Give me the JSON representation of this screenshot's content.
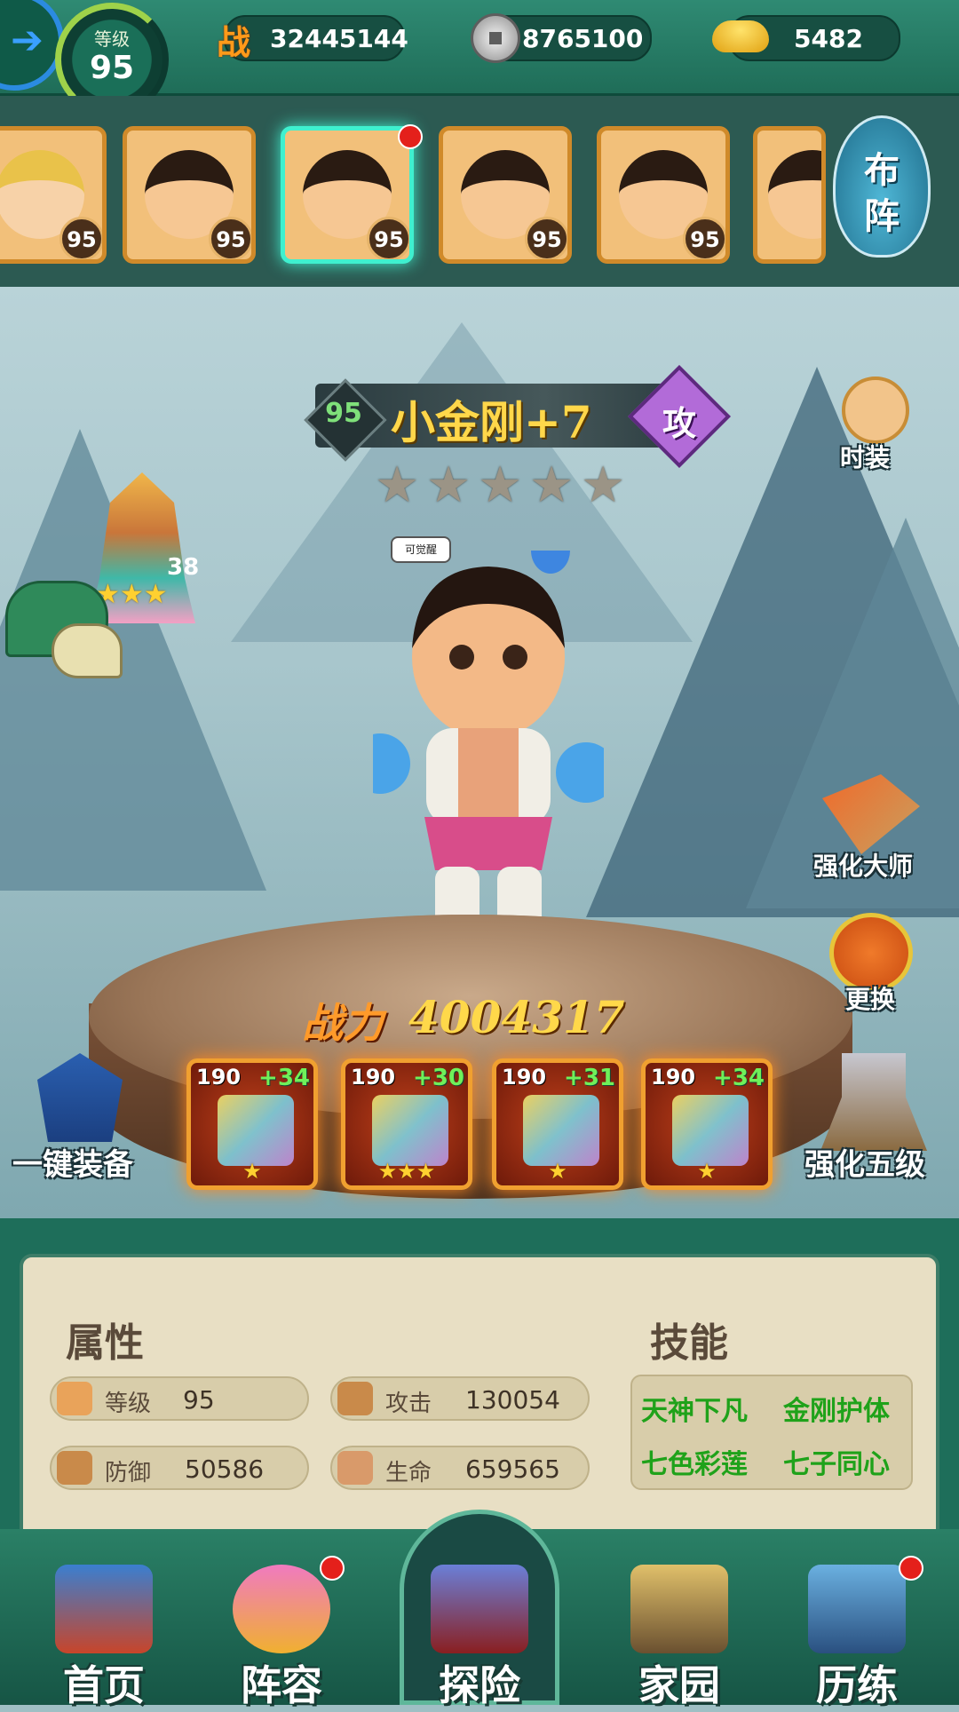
{
  "topbar": {
    "level_label": "等级",
    "level": "95",
    "battle_power_glyph": "战",
    "battle_power": "32445144",
    "silver": "8765100",
    "gold": "5482"
  },
  "hero_strip": {
    "cards": [
      {
        "level": "95",
        "selected": false
      },
      {
        "level": "95",
        "selected": false
      },
      {
        "level": "95",
        "selected": true,
        "alert": true
      },
      {
        "level": "95",
        "selected": false
      },
      {
        "level": "95",
        "selected": false
      }
    ],
    "formation_label_1": "布",
    "formation_label_2": "阵"
  },
  "hero": {
    "level": "95",
    "name": "小金刚+7",
    "class_glyph": "攻",
    "stars": 5,
    "speech": "可觉醒",
    "pagoda_level": "38",
    "power_label": "战力",
    "power_value": "4004317"
  },
  "side_buttons": {
    "fashion": "时装",
    "master": "强化大师",
    "change": "更换",
    "one_key": "一键装备",
    "upgrade": "强化五级"
  },
  "equipment": [
    {
      "level": "190",
      "plus": "+34",
      "stars": "★",
      "icon": "sword-icon"
    },
    {
      "level": "190",
      "plus": "+30",
      "stars": "★★★",
      "icon": "robe-icon"
    },
    {
      "level": "190",
      "plus": "+31",
      "stars": "★",
      "icon": "crown-icon"
    },
    {
      "level": "190",
      "plus": "+34",
      "stars": "★",
      "icon": "necklace-icon"
    }
  ],
  "info": {
    "attributes_title": "属性",
    "skills_title": "技能",
    "stats": [
      {
        "label": "等级",
        "value": "95",
        "icon": "muscle-icon"
      },
      {
        "label": "攻击",
        "value": "130054",
        "icon": "sword-stat-icon"
      },
      {
        "label": "防御",
        "value": "50586",
        "icon": "shield-icon"
      },
      {
        "label": "生命",
        "value": "659565",
        "icon": "lotus-icon"
      }
    ],
    "skills": [
      "天神下凡",
      "金刚护体",
      "七色彩莲",
      "七子同心"
    ]
  },
  "nav": [
    {
      "label": "首页",
      "alert": false
    },
    {
      "label": "阵容",
      "alert": true
    },
    {
      "label": "探险",
      "alert": false
    },
    {
      "label": "家园",
      "alert": false
    },
    {
      "label": "历练",
      "alert": true
    }
  ],
  "colors": {
    "accent_green": "#1fa21a",
    "power_orange": "#ff9a2a",
    "name_gold": "#ffd74a",
    "frame_teal": "#1e6e5a"
  }
}
